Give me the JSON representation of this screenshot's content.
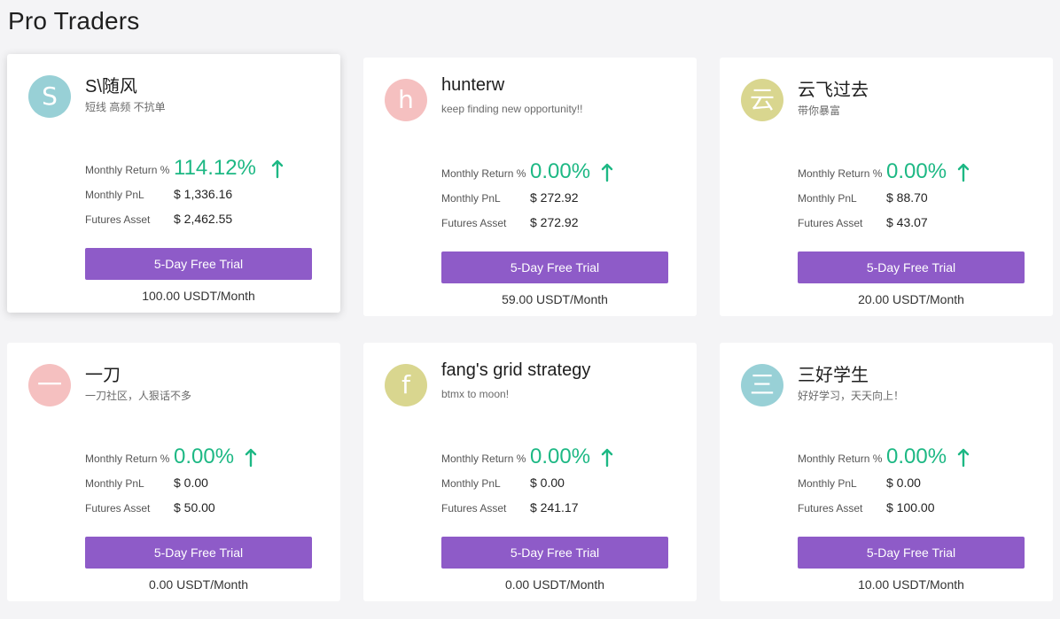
{
  "page": {
    "title": "Pro Traders"
  },
  "labels": {
    "monthly_return": "Monthly Return %",
    "monthly_pnl": "Monthly PnL",
    "futures_asset": "Futures Asset",
    "trial_button": "5-Day Free Trial"
  },
  "colors": {
    "accent_green": "#1db884",
    "button_purple": "#8e5bc8"
  },
  "traders": [
    {
      "avatar_letter": "S",
      "avatar_color": "#98d0d6",
      "name": "S\\随风",
      "bio": "短线 高频 不抗单",
      "monthly_return": "114.12%",
      "return_icon": "arrow-up-icon",
      "monthly_pnl": "$ 1,336.16",
      "futures_asset": "$ 2,462.55",
      "price": "100.00 USDT/Month"
    },
    {
      "avatar_letter": "h",
      "avatar_color": "#f5c0c0",
      "name": "hunterw",
      "bio": "keep finding new opportunity!!",
      "monthly_return": "0.00%",
      "return_icon": "arrow-up-icon",
      "monthly_pnl": "$ 272.92",
      "futures_asset": "$ 272.92",
      "price": "59.00 USDT/Month"
    },
    {
      "avatar_letter": "云",
      "avatar_color": "#d9d68f",
      "name": "云飞过去",
      "bio": "带你暴富",
      "monthly_return": "0.00%",
      "return_icon": "arrow-up-icon",
      "monthly_pnl": "$ 88.70",
      "futures_asset": "$ 43.07",
      "price": "20.00 USDT/Month"
    },
    {
      "avatar_letter": "一",
      "avatar_color": "#f5c0c0",
      "name": "一刀",
      "bio": "一刀社区，人狠话不多",
      "monthly_return": "0.00%",
      "return_icon": "arrow-up-icon",
      "monthly_pnl": "$ 0.00",
      "futures_asset": "$ 50.00",
      "price": "0.00 USDT/Month"
    },
    {
      "avatar_letter": "f",
      "avatar_color": "#d9d68f",
      "name": "fang's grid strategy",
      "bio": "btmx to moon!",
      "monthly_return": "0.00%",
      "return_icon": "arrow-up-icon",
      "monthly_pnl": "$ 0.00",
      "futures_asset": "$ 241.17",
      "price": "0.00 USDT/Month"
    },
    {
      "avatar_letter": "三",
      "avatar_color": "#98d0d6",
      "name": "三好学生",
      "bio": "好好学习，天天向上！",
      "monthly_return": "0.00%",
      "return_icon": "arrow-up-icon",
      "monthly_pnl": "$ 0.00",
      "futures_asset": "$ 100.00",
      "price": "10.00 USDT/Month"
    }
  ]
}
